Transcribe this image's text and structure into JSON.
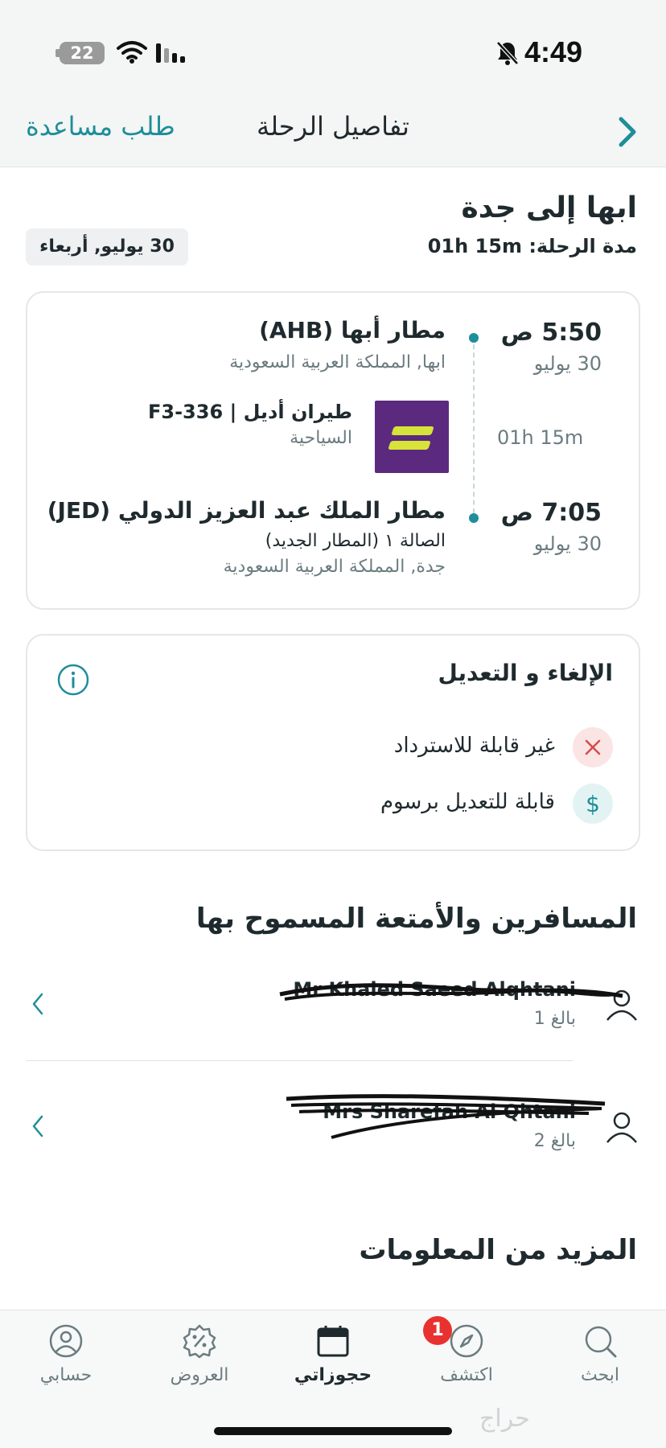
{
  "status_bar": {
    "time": "4:49",
    "battery": "22"
  },
  "header": {
    "title": "تفاصيل الرحلة",
    "help_label": "طلب مساعدة"
  },
  "route": {
    "title": "ابها إلى جدة",
    "duration_label": "مدة الرحلة:",
    "duration_value": "01h 15m",
    "date": "30 يوليو, أربعاء"
  },
  "flight": {
    "departure": {
      "time": "5:50 ص",
      "date": "30 يوليو",
      "airport": "مطار أبها (AHB)",
      "location": "ابها, المملكة العربية السعودية"
    },
    "segment_duration": "01h 15m",
    "airline": {
      "name": "طيران أديل | F3-336",
      "cabin_class": "السياحية",
      "brand_color": "#5b2a7e",
      "accent_color": "#d7e338"
    },
    "arrival": {
      "time": "7:05 ص",
      "date": "30 يوليو",
      "airport": "مطار الملك عبد العزيز الدولي (JED)",
      "terminal": "الصالة ١ (المطار الجديد)",
      "location": "جدة, المملكة العربية السعودية"
    }
  },
  "cancellation": {
    "title": "الإلغاء و التعديل",
    "refund": {
      "label": "غير قابلة للاسترداد",
      "icon": "close-icon"
    },
    "change": {
      "label": "قابلة للتعديل برسوم",
      "icon": "dollar-icon"
    }
  },
  "passengers": {
    "title": "المسافرين والأمتعة المسموح بها",
    "items": [
      {
        "name": "Mr Khaled Saeed Alqhtani",
        "type": "بالغ 1"
      },
      {
        "name": "Mrs Sharefah Al Qhtani",
        "type": "بالغ 2"
      }
    ]
  },
  "more_info": {
    "title": "المزيد من المعلومات"
  },
  "tabs": {
    "account": "حسابي",
    "offers": "العروض",
    "bookings": "حجوزاتي",
    "discover": "اكتشف",
    "search": "ابحث",
    "discover_badge": "1"
  },
  "watermark": "حراج",
  "colors": {
    "accent": "#1e8e9a",
    "badge": "#e8322f"
  }
}
